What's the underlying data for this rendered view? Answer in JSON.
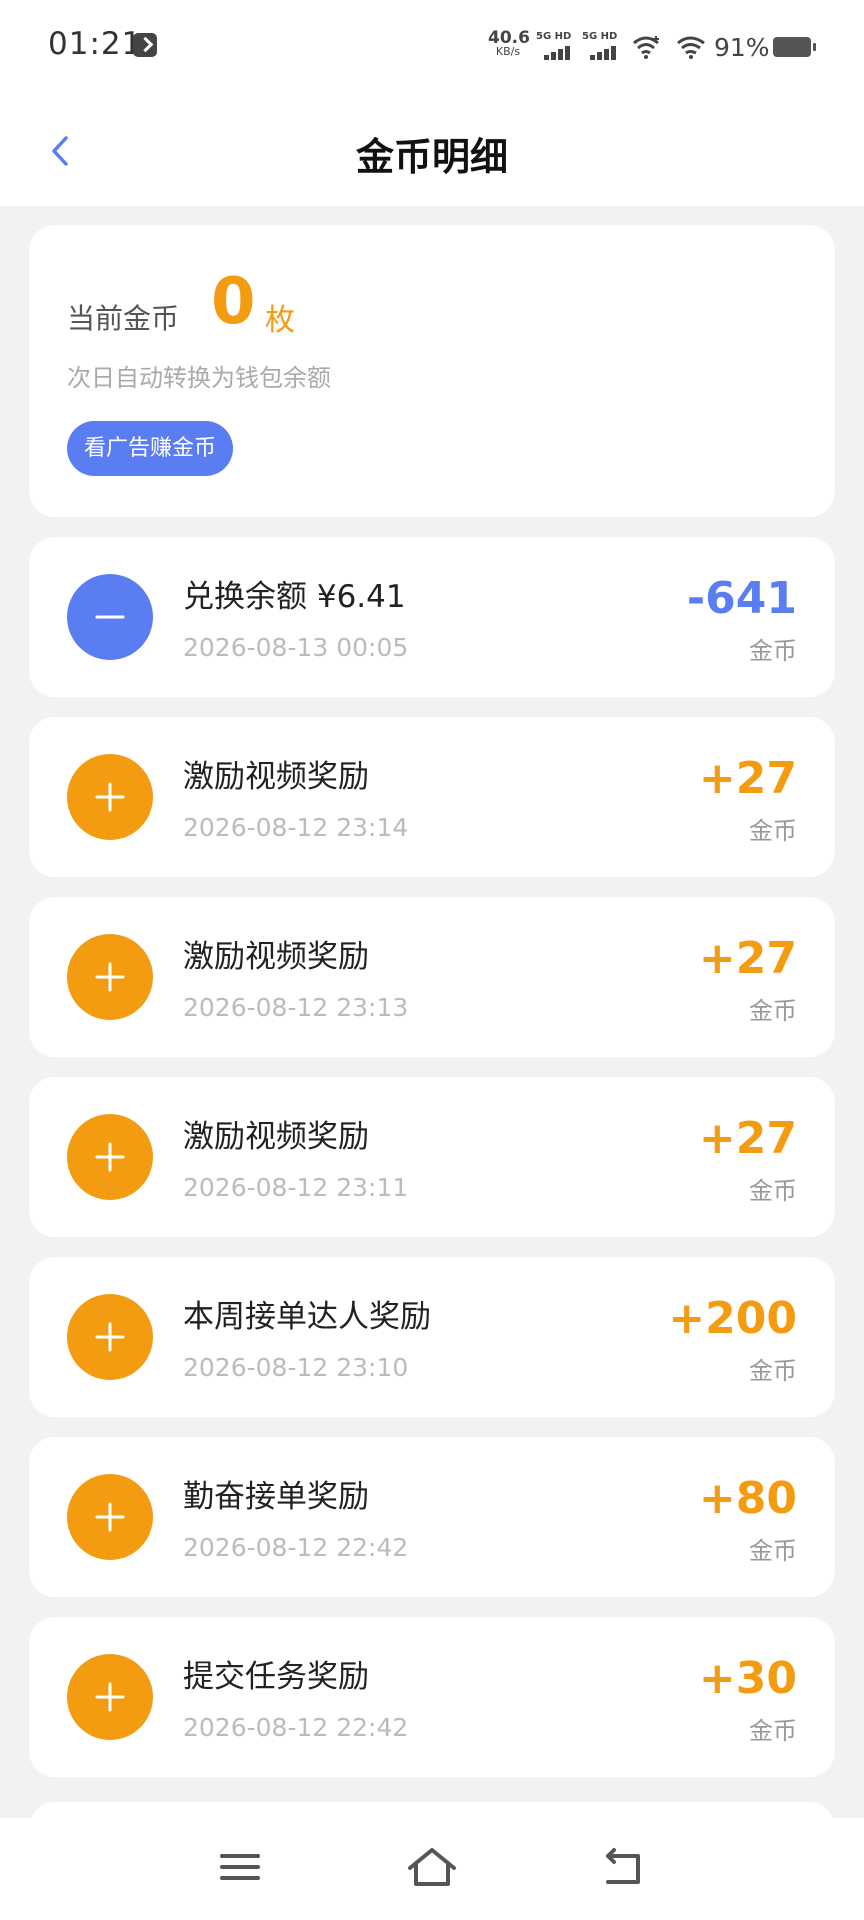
{
  "status_bar": {
    "time": "01:21",
    "net_speed_value": "40.6",
    "net_speed_unit": "KB/s",
    "sim1_label": "5G HD",
    "sim2_label": "5G HD",
    "battery_percent": "91%"
  },
  "header": {
    "title": "金币明细"
  },
  "summary": {
    "label": "当前金币",
    "value": "0",
    "unit": "枚",
    "hint": "次日自动转换为钱包余额",
    "earn_button": "看广告赚金币"
  },
  "transactions": [
    {
      "title": "兑换余额 ¥6.41",
      "time": "2026-08-13 00:05",
      "amount": "-641",
      "unit": "金币",
      "type": "minus"
    },
    {
      "title": "激励视频奖励",
      "time": "2026-08-12 23:14",
      "amount": "+27",
      "unit": "金币",
      "type": "plus"
    },
    {
      "title": "激励视频奖励",
      "time": "2026-08-12 23:13",
      "amount": "+27",
      "unit": "金币",
      "type": "plus"
    },
    {
      "title": "激励视频奖励",
      "time": "2026-08-12 23:11",
      "amount": "+27",
      "unit": "金币",
      "type": "plus"
    },
    {
      "title": "本周接单达人奖励",
      "time": "2026-08-12 23:10",
      "amount": "+200",
      "unit": "金币",
      "type": "plus"
    },
    {
      "title": "勤奋接单奖励",
      "time": "2026-08-12 22:42",
      "amount": "+80",
      "unit": "金币",
      "type": "plus"
    },
    {
      "title": "提交任务奖励",
      "time": "2026-08-12 22:42",
      "amount": "+30",
      "unit": "金币",
      "type": "plus"
    }
  ],
  "icons": {
    "back": "chevron-left-icon",
    "minus": "minus-icon",
    "plus": "plus-icon",
    "menu": "menu-icon",
    "home": "home-icon",
    "back_nav": "back-arrow-icon"
  },
  "colors": {
    "accent_orange": "#f39c12",
    "accent_blue": "#5b7df2"
  }
}
